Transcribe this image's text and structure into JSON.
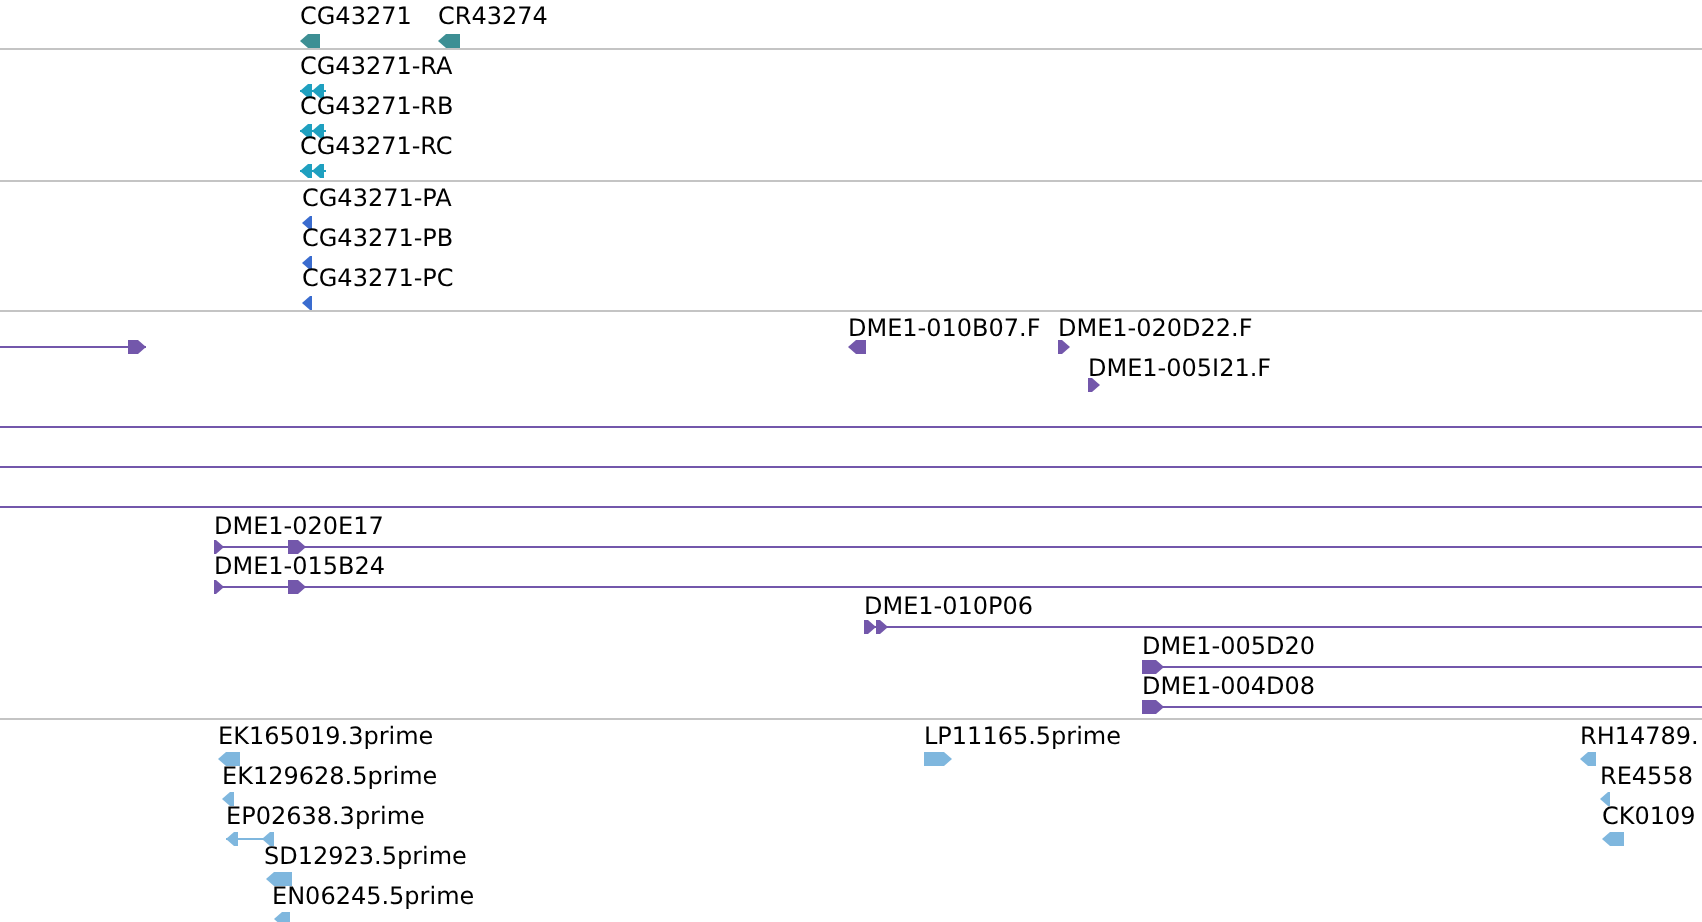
{
  "tracks": [
    {
      "kind": "gene",
      "features": [
        {
          "label": "CG43271",
          "reverse": true
        },
        {
          "label": "CR43274",
          "reverse": true
        }
      ]
    },
    {
      "kind": "transcript",
      "features": [
        {
          "label": "CG43271-RA",
          "reverse": true
        },
        {
          "label": "CG43271-RB",
          "reverse": true
        },
        {
          "label": "CG43271-RC",
          "reverse": true
        }
      ]
    },
    {
      "kind": "protein",
      "features": [
        {
          "label": "CG43271-PA",
          "reverse": true
        },
        {
          "label": "CG43271-PB",
          "reverse": true
        },
        {
          "label": "CG43271-PC",
          "reverse": true
        }
      ]
    },
    {
      "kind": "clone",
      "features": [
        {
          "kind": "arrow",
          "reverse": false
        },
        {
          "kind": "arrow",
          "label": "DME1-010B07.F",
          "reverse": true
        },
        {
          "kind": "arrow",
          "label": "DME1-020D22.F",
          "reverse": false
        },
        {
          "kind": "arrow",
          "label": "DME1-005I21.F",
          "reverse": false
        },
        {
          "kind": "line"
        },
        {
          "kind": "line"
        },
        {
          "kind": "line"
        },
        {
          "kind": "arrow",
          "label": "DME1-020E17",
          "reverse": false
        },
        {
          "kind": "arrow",
          "label": "DME1-015B24",
          "reverse": false
        },
        {
          "kind": "arrow",
          "label": "DME1-010P06",
          "reverse": false
        },
        {
          "kind": "arrow",
          "label": "DME1-005D20",
          "reverse": false
        },
        {
          "kind": "arrow",
          "label": "DME1-004D08",
          "reverse": false
        }
      ]
    },
    {
      "kind": "est",
      "features": [
        {
          "label": "EK165019.3prime",
          "reverse": true
        },
        {
          "label": "EK129628.5prime",
          "reverse": true
        },
        {
          "label": "EP02638.3prime",
          "reverse": true
        },
        {
          "label": "SD12923.5prime",
          "reverse": true
        },
        {
          "label": "EN06245.5prime",
          "reverse": true
        },
        {
          "label": "LP11165.5prime",
          "reverse": false
        },
        {
          "label": "RH14789.",
          "reverse": true
        },
        {
          "label": "RE4558",
          "reverse": true
        },
        {
          "label": "CK0109",
          "reverse": true
        }
      ]
    }
  ]
}
